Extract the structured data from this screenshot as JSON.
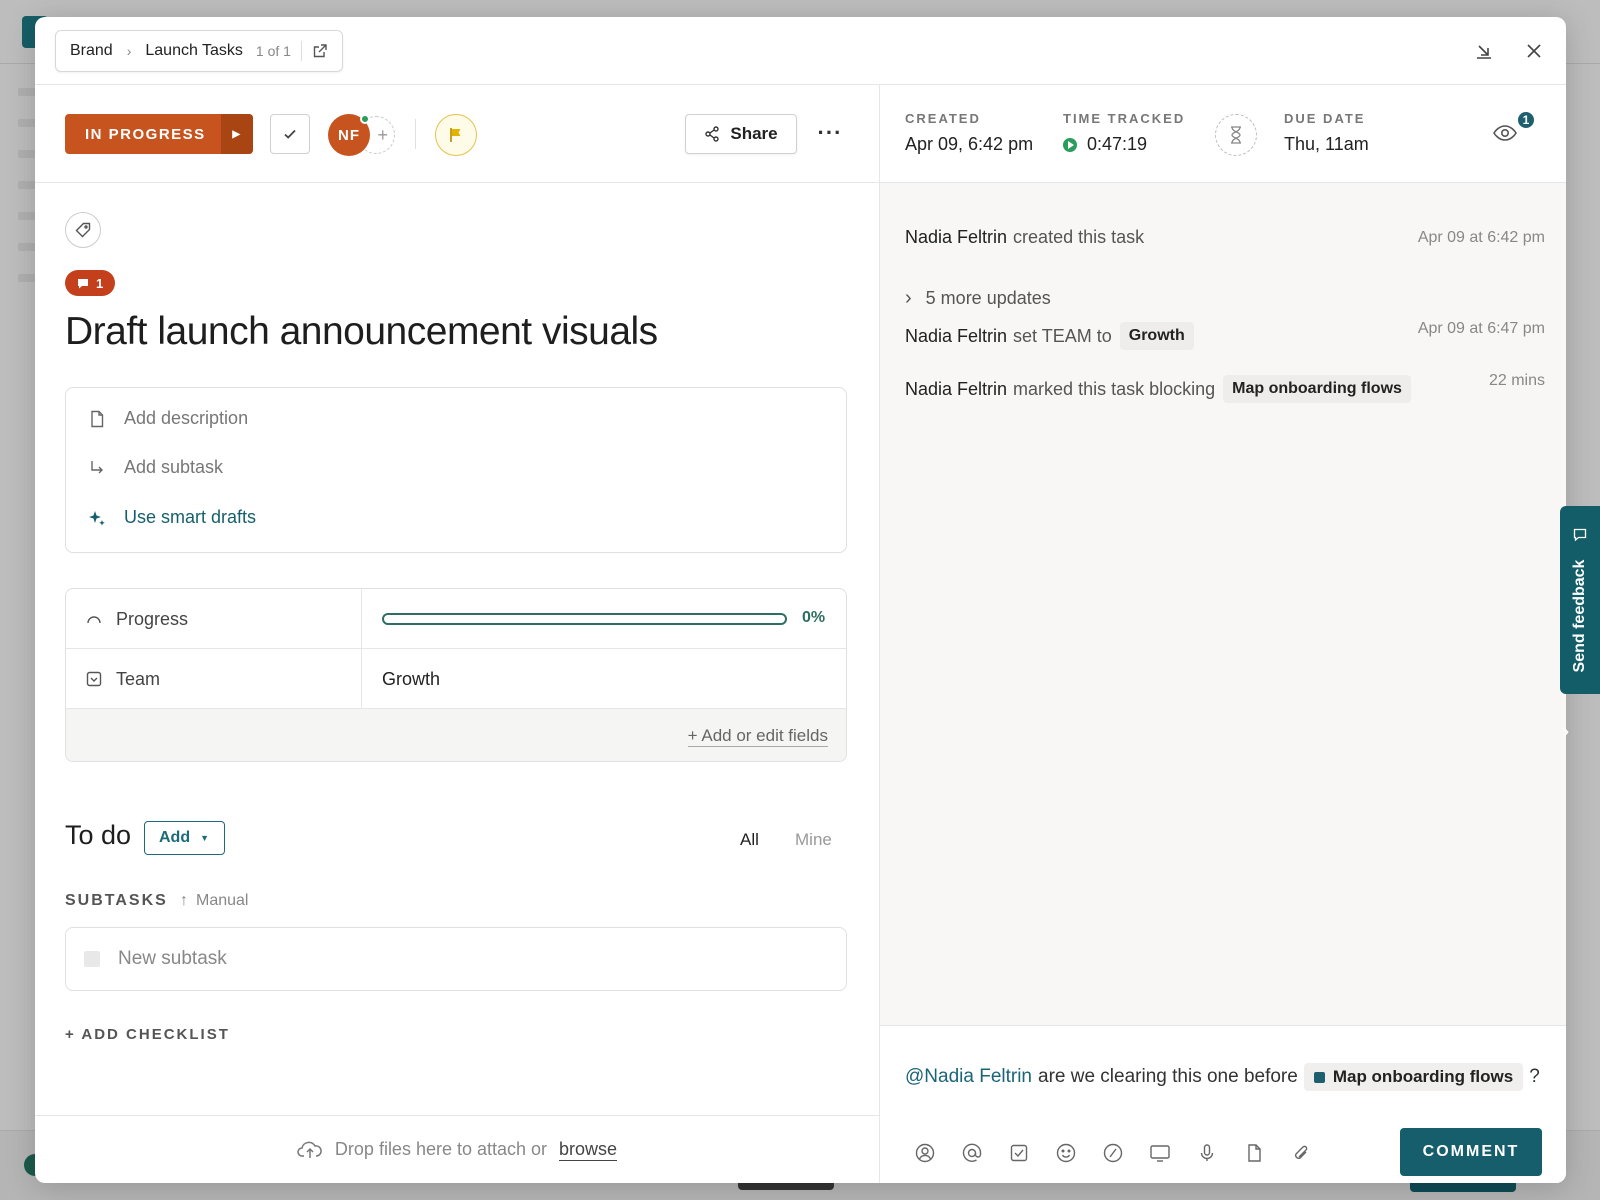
{
  "breadcrumb": {
    "space": "Brand",
    "list": "Launch Tasks",
    "count": "1 of 1"
  },
  "toolbar": {
    "status": "IN PROGRESS",
    "assignee_initials": "NF",
    "share_label": "Share",
    "more_label": "···"
  },
  "task": {
    "comment_count": "1",
    "title": "Draft launch announcement visuals",
    "add_description": "Add description",
    "add_subtask": "Add subtask",
    "smart_drafts": "Use smart drafts"
  },
  "fields": {
    "progress_label": "Progress",
    "progress_value": 0,
    "progress_pct": "0%",
    "team_label": "Team",
    "team_value": "Growth",
    "add_fields": "+ Add or edit fields"
  },
  "todo": {
    "title": "To do",
    "add_label": "Add",
    "filter_all": "All",
    "filter_mine": "Mine",
    "subtasks_header": "SUBTASKS",
    "sort_label": "Manual",
    "new_subtask_placeholder": "New subtask",
    "add_checklist": "+ ADD CHECKLIST"
  },
  "dropzone": {
    "text": "Drop files here to attach or",
    "browse": "browse"
  },
  "meta": {
    "created_label": "CREATED",
    "created_value": "Apr 09, 6:42 pm",
    "time_label": "TIME TRACKED",
    "time_value": "0:47:19",
    "due_label": "DUE DATE",
    "due_value": "Thu, 11am",
    "watchers_count": "1"
  },
  "activity": {
    "items": [
      {
        "who": "Nadia Feltrin",
        "action": "created this task",
        "chip": "",
        "time": "Apr 09 at 6:42 pm"
      },
      {
        "who": "Nadia Feltrin",
        "action": "set TEAM to",
        "chip": "Growth",
        "time": "Apr 09 at 6:47 pm"
      },
      {
        "who": "Nadia Feltrin",
        "action": "marked this task blocking",
        "chip": "Map onboarding flows",
        "time": "22 mins"
      }
    ],
    "more_updates": "5 more updates"
  },
  "composer": {
    "mention": "@Nadia Feltrin",
    "text_before": "are we clearing this one before",
    "task_chip": "Map onboarding flows",
    "text_after": "?",
    "submit_label": "COMMENT"
  },
  "feedback": {
    "label": "Send feedback"
  },
  "colors": {
    "status": "#c7531f",
    "accent": "#165e6c",
    "progress": "#2e6f62",
    "badge": "#c4401c"
  },
  "icons": [
    "external-link-icon",
    "minimize-icon",
    "close-icon",
    "check-icon",
    "flag-icon",
    "share-icon",
    "tag-icon",
    "comment-icon",
    "document-icon",
    "subtask-icon",
    "sparkle-icon",
    "progress-icon",
    "dropdown-field-icon",
    "sort-up-icon",
    "cloud-upload-icon",
    "hourglass-icon",
    "eye-icon",
    "assign-icon",
    "mention-icon",
    "task-icon",
    "emoji-icon",
    "slash-icon",
    "screen-icon",
    "mic-icon",
    "doc-icon",
    "paperclip-icon",
    "chat-icon"
  ]
}
